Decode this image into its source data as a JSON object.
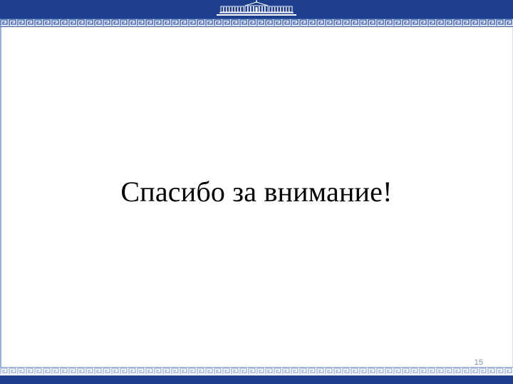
{
  "slide": {
    "title": "Спасибо за внимание!",
    "page_number": "15"
  },
  "theme": {
    "header_color": "#1e3f8c",
    "ornament_color": "#3a5ba8",
    "ornament_light": "#c9d6ee"
  },
  "decorations": {
    "header_icon": "government-building-icon",
    "ornament": "greek-key-border"
  }
}
